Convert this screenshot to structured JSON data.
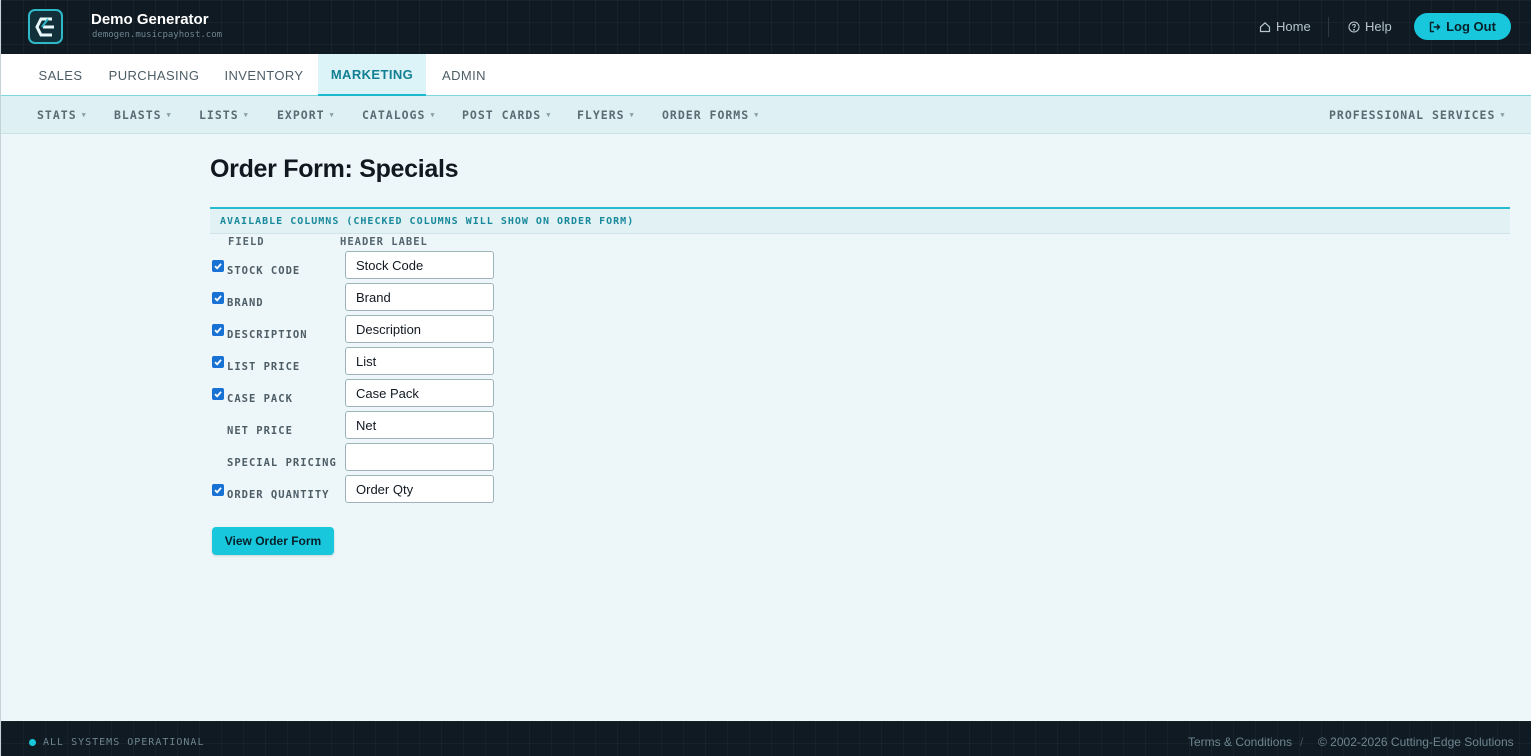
{
  "app": {
    "title": "Demo Generator",
    "subtitle": "demogen.musicpayhost.com",
    "logo_icon": "cutting-edge-logo"
  },
  "header": {
    "home_label": "Home",
    "help_label": "Help",
    "logout_label": "Log Out"
  },
  "main_nav": {
    "tabs": [
      {
        "label": "SALES",
        "active": false
      },
      {
        "label": "PURCHASING",
        "active": false
      },
      {
        "label": "INVENTORY",
        "active": false
      },
      {
        "label": "MARKETING",
        "active": true
      },
      {
        "label": "ADMIN",
        "active": false
      }
    ]
  },
  "sub_nav": {
    "items": [
      {
        "label": "STATS"
      },
      {
        "label": "BLASTS"
      },
      {
        "label": "LISTS"
      },
      {
        "label": "EXPORT"
      },
      {
        "label": "CATALOGS"
      },
      {
        "label": "POST CARDS"
      },
      {
        "label": "FLYERS"
      },
      {
        "label": "ORDER FORMS"
      },
      {
        "label": "PROFESSIONAL SERVICES"
      }
    ]
  },
  "content": {
    "page_title": "Order Form: Specials",
    "section_title": "AVAILABLE COLUMNS (CHECKED COLUMNS WILL SHOW ON ORDER FORM)",
    "col_field": "FIELD",
    "col_header_label": "HEADER LABEL",
    "rows": [
      {
        "field": "STOCK CODE",
        "checked": true,
        "value": "Stock Code"
      },
      {
        "field": "BRAND",
        "checked": true,
        "value": "Brand"
      },
      {
        "field": "DESCRIPTION",
        "checked": true,
        "value": "Description"
      },
      {
        "field": "LIST PRICE",
        "checked": true,
        "value": "List"
      },
      {
        "field": "CASE PACK",
        "checked": true,
        "value": "Case Pack"
      },
      {
        "field": "NET PRICE",
        "checked": false,
        "value": "Net"
      },
      {
        "field": "SPECIAL PRICING",
        "checked": false,
        "value": ""
      },
      {
        "field": "ORDER QUANTITY",
        "checked": true,
        "value": "Order Qty"
      }
    ],
    "view_button": "View Order Form"
  },
  "footer": {
    "status": "ALL SYSTEMS OPERATIONAL",
    "terms": "Terms & Conditions",
    "separator": "/",
    "copyright": "© 2002-2026 Cutting-Edge Solutions"
  },
  "colors": {
    "accent": "#19c7dc",
    "header_bg": "#0f1a22",
    "active_tab_text": "#127f93"
  }
}
